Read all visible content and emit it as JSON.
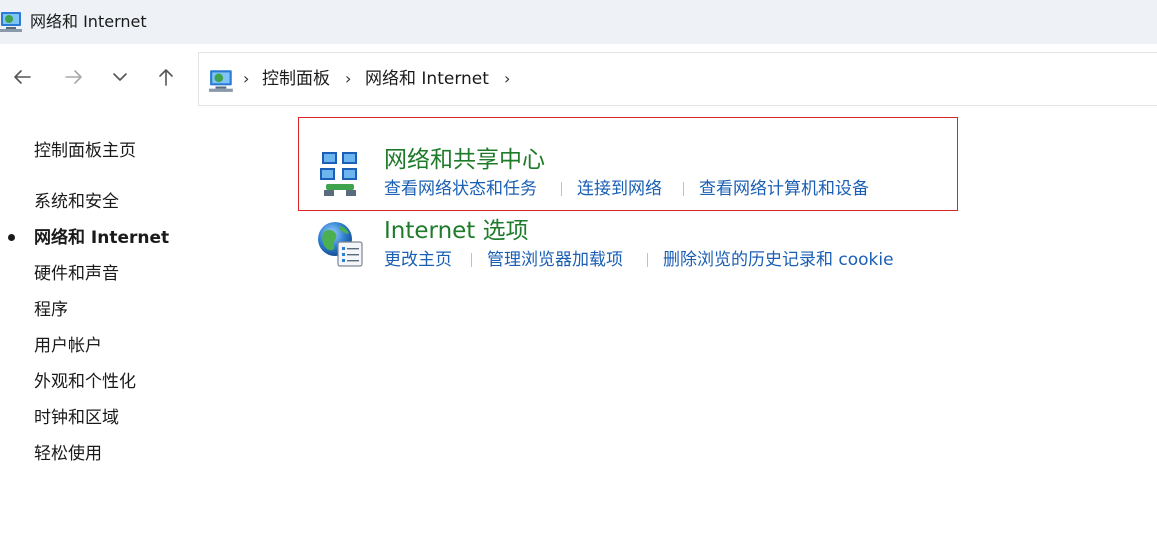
{
  "window": {
    "title": "网络和 Internet",
    "title_icon": "control-panel-icon"
  },
  "nav": {
    "back_icon": "arrow-left-icon",
    "forward_icon": "arrow-right-icon",
    "recent_icon": "chevron-down-icon",
    "up_icon": "arrow-up-icon"
  },
  "address": {
    "icon": "control-panel-icon",
    "crumbs": [
      "控制面板",
      "网络和 Internet"
    ],
    "separator": "›"
  },
  "sidebar": {
    "items": [
      {
        "label": "控制面板主页",
        "active": false
      },
      {
        "label": "系统和安全",
        "active": false
      },
      {
        "label": "网络和 Internet",
        "active": true
      },
      {
        "label": "硬件和声音",
        "active": false
      },
      {
        "label": "程序",
        "active": false
      },
      {
        "label": "用户帐户",
        "active": false
      },
      {
        "label": "外观和个性化",
        "active": false
      },
      {
        "label": "时钟和区域",
        "active": false
      },
      {
        "label": "轻松使用",
        "active": false
      }
    ]
  },
  "categories": [
    {
      "title": "网络和共享中心",
      "icon": "network-sharing-icon",
      "links": [
        "查看网络状态和任务",
        "连接到网络",
        "查看网络计算机和设备"
      ],
      "highlighted": true
    },
    {
      "title": "Internet 选项",
      "icon": "internet-options-icon",
      "links": [
        "更改主页",
        "管理浏览器加载项",
        "删除浏览的历史记录和 cookie"
      ],
      "highlighted": false
    }
  ],
  "colors": {
    "title_bar": "#eef2f7",
    "category_title": "#1e7b2a",
    "link": "#1a5fb4",
    "highlight_border": "#d9262b"
  }
}
